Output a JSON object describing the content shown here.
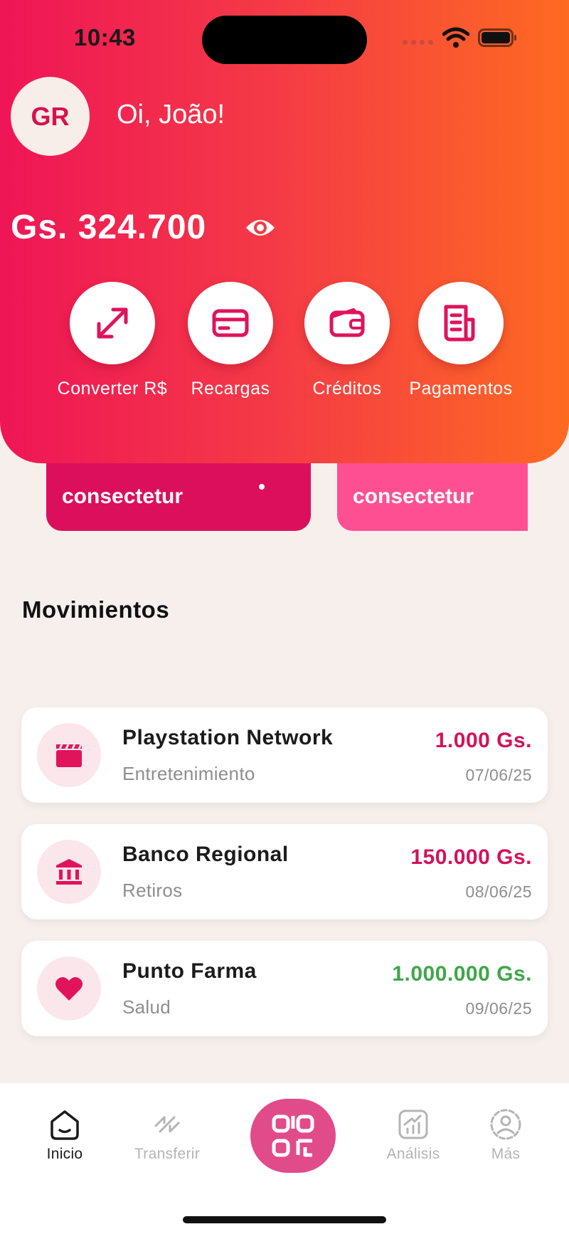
{
  "status_bar": {
    "time": "10:43"
  },
  "user": {
    "initials": "GR",
    "greeting": "Oi, João!"
  },
  "wallet": {
    "balance": "Gs. 324.700"
  },
  "actions": [
    {
      "label": "Converter R$",
      "icon": "convert-arrows-icon"
    },
    {
      "label": "Recargas",
      "icon": "card-icon"
    },
    {
      "label": "Créditos",
      "icon": "wallet-icon"
    },
    {
      "label": "Pagamentos",
      "icon": "receipt-icon"
    }
  ],
  "promos": [
    {
      "text": "consectetur",
      "color": "#dc0f5c"
    },
    {
      "text": "consectetur",
      "color": "#ff4f93"
    }
  ],
  "movements": {
    "title": "Movimientos",
    "items": [
      {
        "title": "Playstation Network",
        "category": "Entretenimiento",
        "amount": "1.000 Gs.",
        "date": "07/06/25",
        "icon": "clapperboard-icon",
        "amount_color": "#d4125a"
      },
      {
        "title": "Banco Regional",
        "category": "Retiros",
        "amount": "150.000 Gs.",
        "date": "08/06/25",
        "icon": "bank-icon",
        "amount_color": "#d4125a"
      },
      {
        "title": "Punto Farma",
        "category": "Salud",
        "amount": "1.000.000 Gs.",
        "date": "09/06/25",
        "icon": "heart-icon",
        "amount_color": "#3fa64b"
      }
    ]
  },
  "bottom_nav": {
    "items": [
      {
        "label": "Inicio",
        "icon": "home-icon",
        "active": true
      },
      {
        "label": "Transferir",
        "icon": "transfer-icon",
        "active": false
      },
      {
        "label": "Análisis",
        "icon": "chart-icon",
        "active": false
      },
      {
        "label": "Más",
        "icon": "user-circle-icon",
        "active": false
      }
    ],
    "center_icon": "qr-code-icon"
  },
  "colors": {
    "accent": "#e0135b",
    "gradient_start": "#ef1556",
    "gradient_end": "#fe6a21",
    "background": "#f6efec"
  }
}
